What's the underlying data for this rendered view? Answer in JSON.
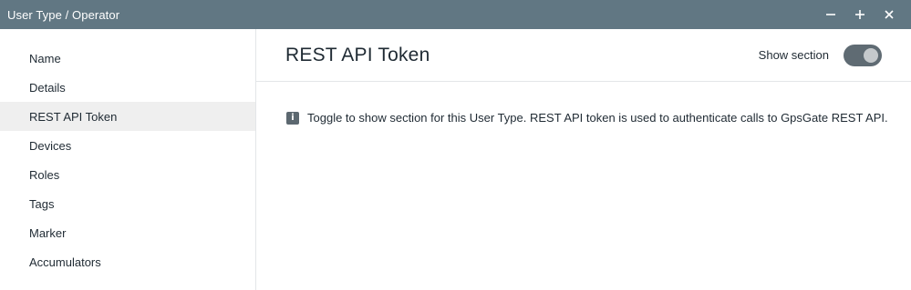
{
  "window": {
    "title": "User Type / Operator",
    "controls": [
      {
        "name": "minimize-icon"
      },
      {
        "name": "maximize-icon"
      },
      {
        "name": "close-icon"
      }
    ]
  },
  "sidebar": {
    "items": [
      {
        "label": "Name",
        "active": false
      },
      {
        "label": "Details",
        "active": false
      },
      {
        "label": "REST API Token",
        "active": true
      },
      {
        "label": "Devices",
        "active": false
      },
      {
        "label": "Roles",
        "active": false
      },
      {
        "label": "Tags",
        "active": false
      },
      {
        "label": "Marker",
        "active": false
      },
      {
        "label": "Accumulators",
        "active": false
      }
    ]
  },
  "main": {
    "title": "REST API Token",
    "show_section_label": "Show section",
    "show_section_enabled": true,
    "info_icon": "info-icon",
    "info_text": "Toggle to show section for this User Type. REST API token is used to authenticate calls to GpsGate REST API."
  },
  "colors": {
    "titlebar": "#617783",
    "active_item": "#efefef",
    "toggle_on": "#5f6b73"
  }
}
